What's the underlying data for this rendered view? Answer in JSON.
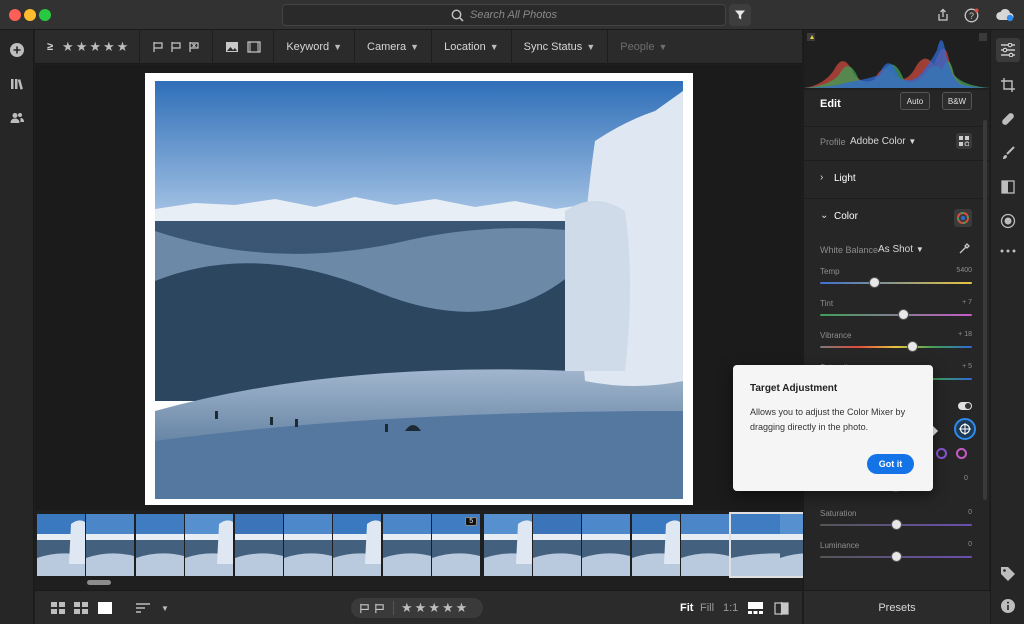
{
  "titlebar": {
    "search_placeholder": "Search All Photos",
    "icons": [
      "filter-icon",
      "share-icon",
      "help-icon",
      "cloud-sync-icon"
    ]
  },
  "leftrail": {
    "icons": [
      "add-icon",
      "library-icon",
      "people-icon"
    ]
  },
  "toolbar": {
    "rating_filter_symbol": "≥",
    "stars": [
      "★",
      "★",
      "★",
      "★",
      "★"
    ],
    "menus": [
      {
        "label": "Keyword",
        "enabled": true
      },
      {
        "label": "Camera",
        "enabled": true
      },
      {
        "label": "Location",
        "enabled": true
      },
      {
        "label": "Sync Status",
        "enabled": true
      },
      {
        "label": "People",
        "enabled": false
      }
    ]
  },
  "filmstrip": {
    "badges": [
      {
        "thumb_index": 8,
        "text": "5"
      },
      {
        "thumb_index": 14,
        "text": "5"
      }
    ],
    "selected_index": 14
  },
  "bottombar": {
    "stars": [
      "★",
      "★",
      "★",
      "★",
      "★"
    ],
    "zoom": {
      "fit": "Fit",
      "fill": "Fill",
      "one_to_one": "1:1",
      "active": "fit"
    }
  },
  "edit": {
    "title": "Edit",
    "auto_label": "Auto",
    "bw_label": "B&W",
    "profile_label": "Profile",
    "profile_value": "Adobe Color",
    "light_label": "Light",
    "color_label": "Color",
    "white_balance_label": "White Balance",
    "white_balance_value": "As Shot",
    "sliders": [
      {
        "label": "Temp",
        "value": "5400",
        "position": 0.36
      },
      {
        "label": "Tint",
        "value": "+ 7",
        "position": 0.55
      },
      {
        "label": "Vibrance",
        "value": "+ 18",
        "position": 0.61
      },
      {
        "label": "Saturation",
        "value": "+ 5",
        "position": 0.5
      }
    ],
    "mixer_sliders": [
      {
        "label": "Saturation",
        "value": "0",
        "position": 0.5
      },
      {
        "label": "Luminance",
        "value": "0",
        "position": 0.5
      }
    ],
    "presets_label": "Presets"
  },
  "tools": {
    "icons": [
      "edit-sliders-icon",
      "crop-icon",
      "healing-icon",
      "brush-icon",
      "linear-gradient-icon",
      "radial-gradient-icon",
      "more-icon",
      "tag-icon",
      "info-icon"
    ]
  },
  "popover": {
    "title": "Target Adjustment",
    "body": "Allows you to adjust the Color Mixer by dragging directly in the photo.",
    "button": "Got it"
  },
  "colors": {
    "accent": "#1473e6",
    "panel_bg": "#262626",
    "target_ring": "#2d8ceb"
  }
}
